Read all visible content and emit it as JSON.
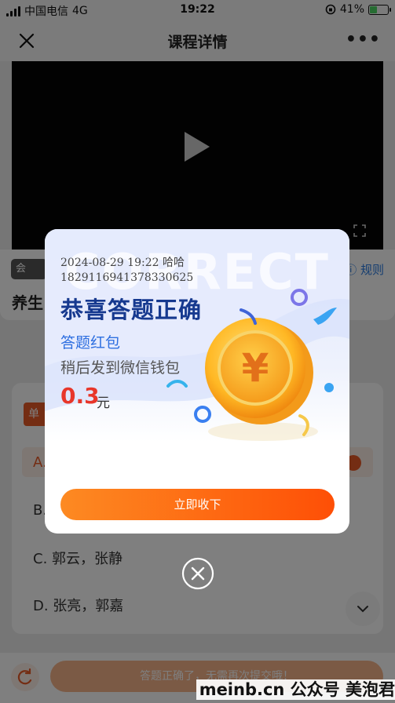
{
  "status_bar": {
    "carrier": "中国电信",
    "network": "4G",
    "time": "19:22",
    "battery": "41%",
    "battery_level": 0.41
  },
  "nav": {
    "title": "课程详情"
  },
  "page": {
    "member_badge": "会",
    "rules_link": "规则",
    "course_title": "养生",
    "question_type": "单",
    "options": {
      "a": "A.",
      "b": "B.",
      "c": "C. 郭云，张静",
      "d": "D. 张亮，郭嘉"
    },
    "submit_text": "答题正确了，无需再次提交哦！"
  },
  "popup": {
    "watermark_text": "CORRECT",
    "timestamp_line": "2024-08-29 19:22 哈哈",
    "id_line": "1829116941378330625",
    "title": "恭喜答题正确",
    "subtitle": "答题红包",
    "description": "稍后发到微信钱包",
    "amount": "0.3",
    "unit": "元",
    "collect_button": "立即收下",
    "coin_symbol": "¥"
  },
  "footer_watermark": "meinb.cn 公众号 美泡君",
  "colors": {
    "accent": "#fe4f06",
    "title_blue": "#16398f",
    "subtitle_blue": "#2e6fe0",
    "amount_red": "#e8362a"
  }
}
